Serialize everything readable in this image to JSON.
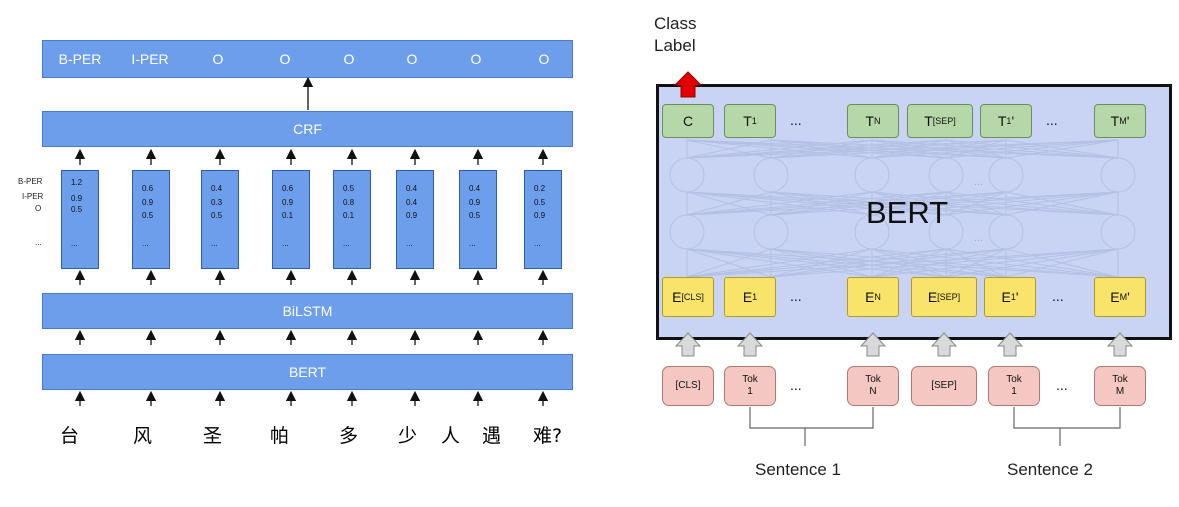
{
  "left": {
    "tags": [
      "B-PER",
      "I-PER",
      "O",
      "O",
      "O",
      "O",
      "O",
      "O"
    ],
    "crf_label": "CRF",
    "bilstm_label": "BiLSTM",
    "bert_label": "BERT",
    "row_labels": [
      "B-PER",
      "I-PER",
      "O"
    ],
    "row_dots": "...",
    "columns": [
      {
        "v1": "1.2",
        "v2": "0.9",
        "v3": "0.5"
      },
      {
        "v1": "0.6",
        "v2": "0.9",
        "v3": "0.5"
      },
      {
        "v1": "0.4",
        "v2": "0.3",
        "v3": "0.5"
      },
      {
        "v1": "0.6",
        "v2": "0.9",
        "v3": "0.1"
      },
      {
        "v1": "0.5",
        "v2": "0.8",
        "v3": "0.1"
      },
      {
        "v1": "0.4",
        "v2": "0.4",
        "v3": "0.9"
      },
      {
        "v1": "0.4",
        "v2": "0.9",
        "v3": "0.5"
      },
      {
        "v1": "0.2",
        "v2": "0.5",
        "v3": "0.9"
      }
    ],
    "col_dots": "...",
    "chars": [
      "台",
      "风",
      "圣",
      "帕",
      "多",
      "少",
      "人",
      "遇",
      "难?"
    ]
  },
  "right": {
    "class_label": [
      "Class",
      "Label"
    ],
    "bert_label": "BERT",
    "outputs": [
      "C",
      "T1",
      "...",
      "TN",
      "T[SEP]",
      "T1'",
      "...",
      "TM'"
    ],
    "embeddings": [
      "E[CLS]",
      "E1",
      "...",
      "EN",
      "E[SEP]",
      "E1'",
      "...",
      "EM'"
    ],
    "tokens": [
      "[CLS]",
      "Tok 1",
      "...",
      "Tok N",
      "[SEP]",
      "Tok 1",
      "...",
      "Tok M"
    ],
    "sentence1": "Sentence 1",
    "sentence2": "Sentence 2",
    "hidden_dots": "...",
    "colors": {
      "arrow_red": "#e00000",
      "output_green": "#b6d7a8",
      "embed_yellow": "#f8e36b",
      "token_pink": "#f4c7c3",
      "panel_blue": "#c9d4f4",
      "bar_blue": "#6d9eeb"
    }
  }
}
